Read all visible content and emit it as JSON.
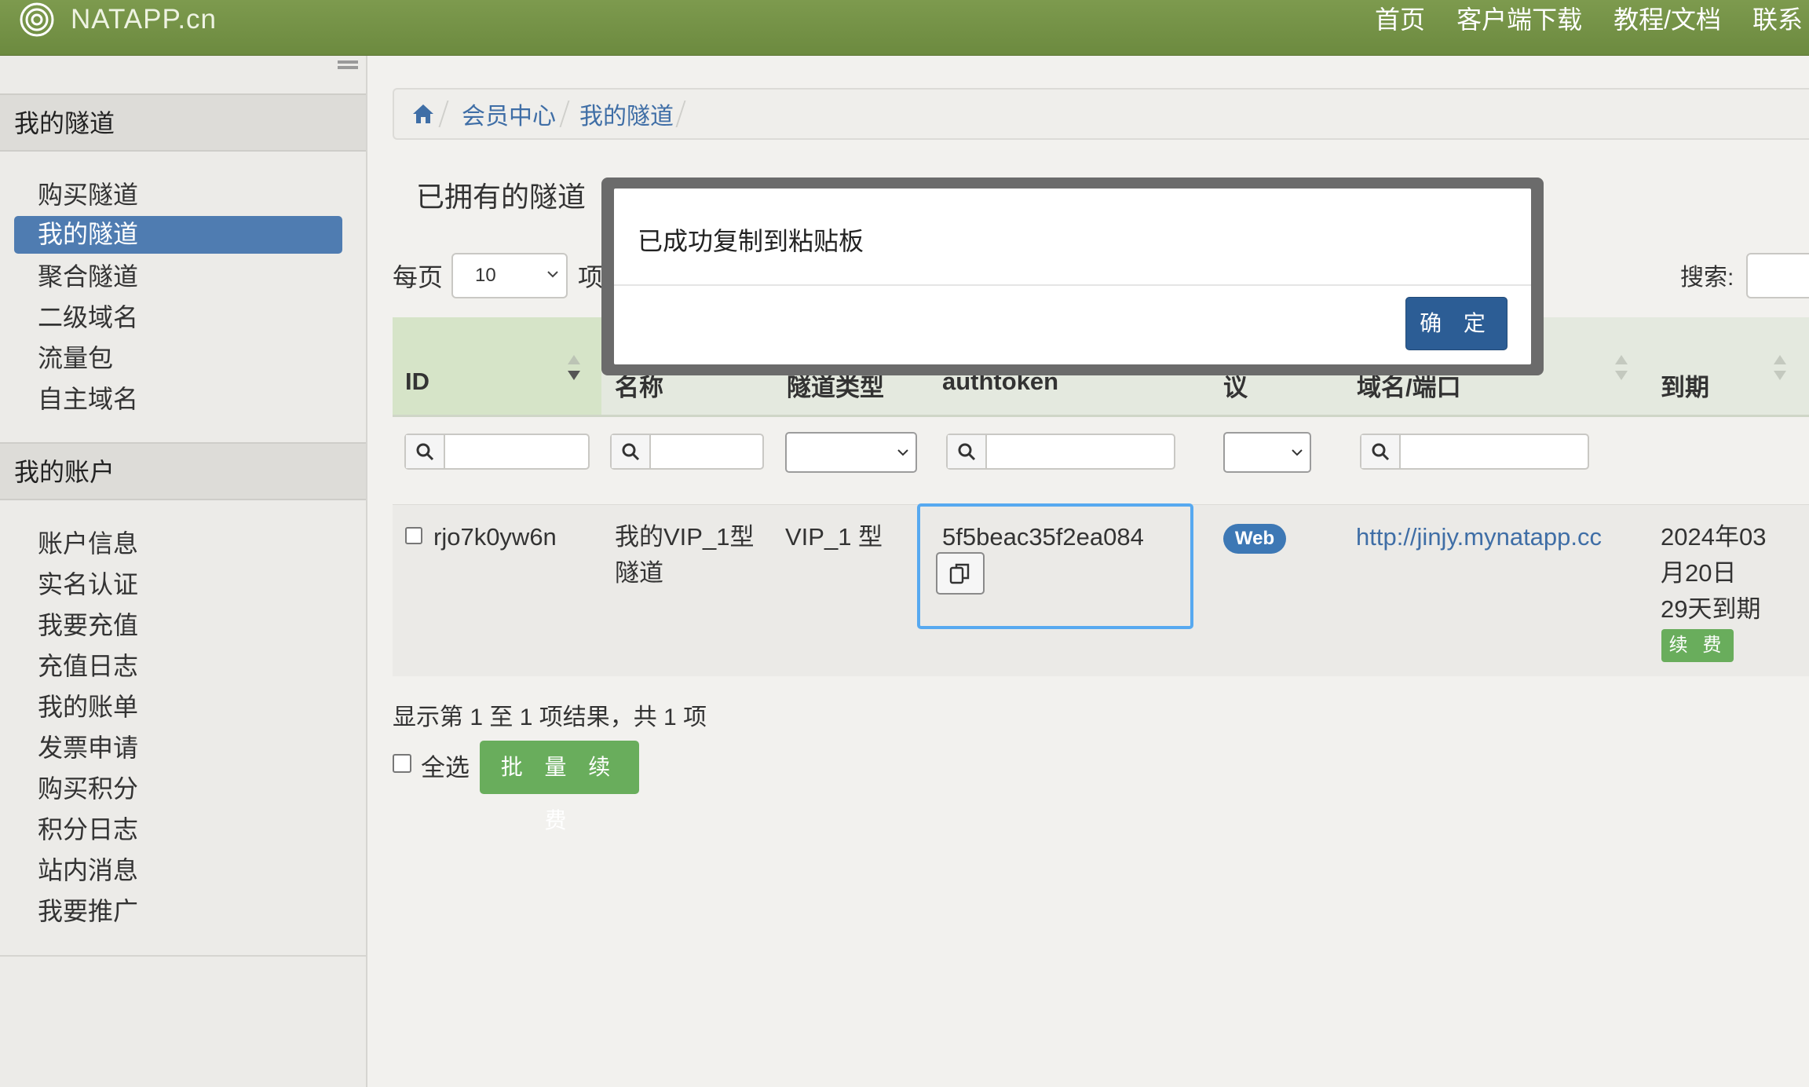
{
  "brand": {
    "name": "NATAPP.cn"
  },
  "topnav": [
    "首页",
    "客户端下载",
    "教程/文档",
    "联系"
  ],
  "sidebar": {
    "tunnels_header": "我的隧道",
    "tunnel_items": [
      "购买隧道",
      "我的隧道",
      "聚合隧道",
      "二级域名",
      "流量包",
      "自主域名"
    ],
    "account_header": "我的账户",
    "account_items": [
      "账户信息",
      "实名认证",
      "我要充值",
      "充值日志",
      "我的账单",
      "发票申请",
      "购买积分",
      "积分日志",
      "站内消息",
      "我要推广"
    ]
  },
  "breadcrumb": [
    "会员中心",
    "我的隧道"
  ],
  "page_title": "已拥有的隧道",
  "table_controls": {
    "per_page_label": "每页",
    "per_page_value": "10",
    "per_page_suffix": "项",
    "search_label": "搜索:"
  },
  "columns": [
    "ID",
    "名称",
    "隧道类型",
    "authtoken",
    "议",
    "域名/端口",
    "到期"
  ],
  "rows": [
    {
      "id": "rjo7k0yw6n",
      "name": "我的VIP_1型隧道",
      "type": "VIP_1 型",
      "authtoken": "5f5beac35f2ea084",
      "protocol": "Web",
      "domain": "http://jinjy.mynatapp.cc",
      "expire": "2024年03月20日",
      "expire_note": "29天到期",
      "renew_label": "续 费"
    }
  ],
  "summary": "显示第 1 至 1 项结果，共 1 项",
  "select_all_label": "全选",
  "batch_renew_label": "批 量 续 费",
  "modal": {
    "message": "已成功复制到粘贴板",
    "ok_label": "确 定"
  },
  "colors": {
    "topbar": "#6f8c42",
    "active_nav": "#4f7cb1",
    "link": "#3f6ea6",
    "green_button": "#69ad5c",
    "modal_button": "#2c5d95",
    "focus_border": "#57a9f0"
  }
}
